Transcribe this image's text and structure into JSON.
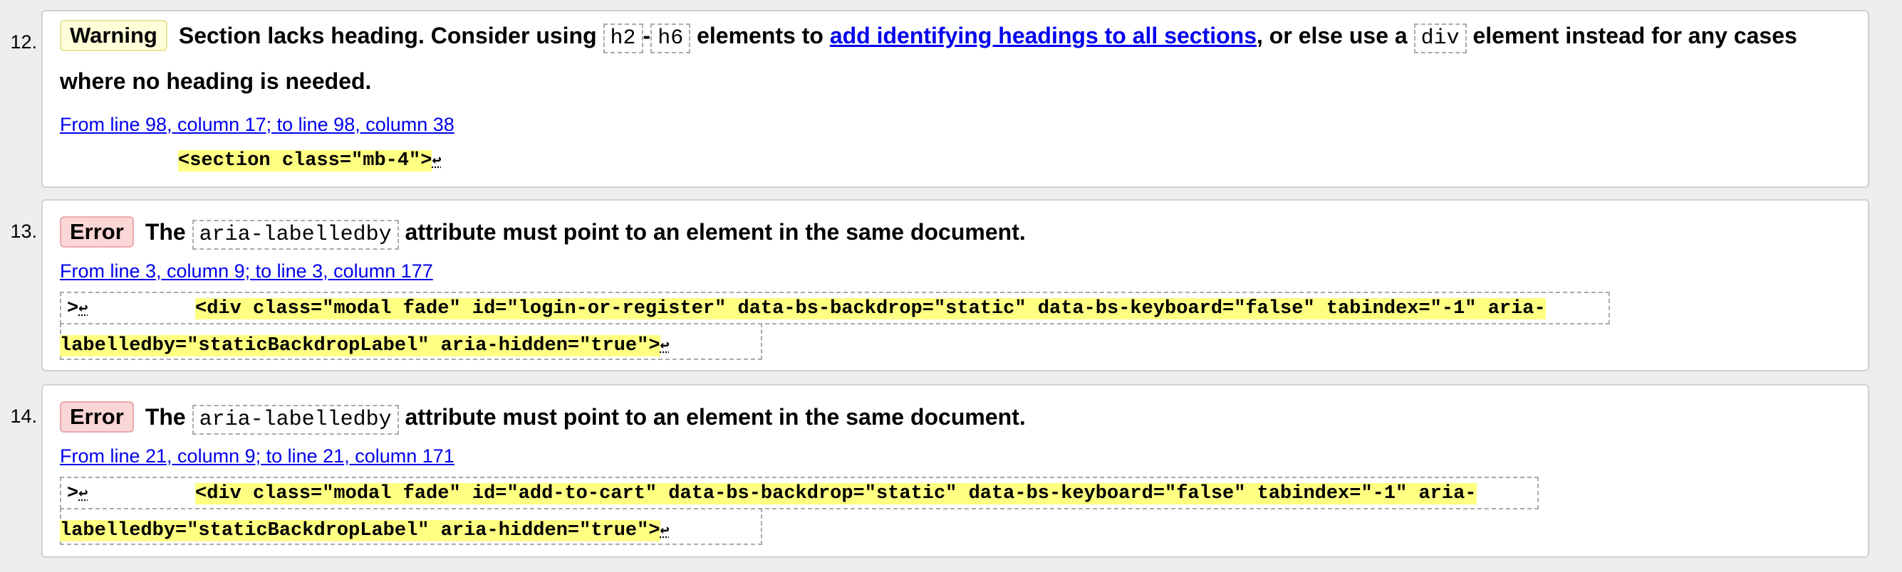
{
  "messages": [
    {
      "number": "12.",
      "type": "Warning",
      "text_before": "Section lacks heading. Consider using",
      "code1": "h2",
      "dash": "-",
      "code2": "h6",
      "text_mid": "elements to",
      "link": "add identifying headings to all sections",
      "text_mid2": ", or else use a",
      "code3": "div",
      "text_after": "element instead for any cases where no heading is needed.",
      "location": "From line 98, column 17; to line 98, column 38",
      "extract": "<section class=\"mb-4\">",
      "return_glyph": "↩"
    },
    {
      "number": "13.",
      "type": "Error",
      "text_before": "The",
      "code": "aria-labelledby",
      "text_after": "attribute must point to an element in the same document.",
      "location": "From line 3, column 9; to line 3, column 177",
      "prefix": ">",
      "extract_line1": "<div class=\"modal fade\" id=\"login-or-register\" data-bs-backdrop=\"static\" data-bs-keyboard=\"false\" tabindex=\"-1\" aria-",
      "extract_line2": "labelledby=\"staticBackdropLabel\" aria-hidden=\"true\">",
      "return_glyph": "↩"
    },
    {
      "number": "14.",
      "type": "Error",
      "text_before": "The",
      "code": "aria-labelledby",
      "text_after": "attribute must point to an element in the same document.",
      "location": "From line 21, column 9; to line 21, column 171",
      "prefix": ">",
      "extract_line1": "<div class=\"modal fade\" id=\"add-to-cart\" data-bs-backdrop=\"static\" data-bs-keyboard=\"false\" tabindex=\"-1\" aria-",
      "extract_line2": "labelledby=\"staticBackdropLabel\" aria-hidden=\"true\">",
      "return_glyph": "↩"
    }
  ]
}
